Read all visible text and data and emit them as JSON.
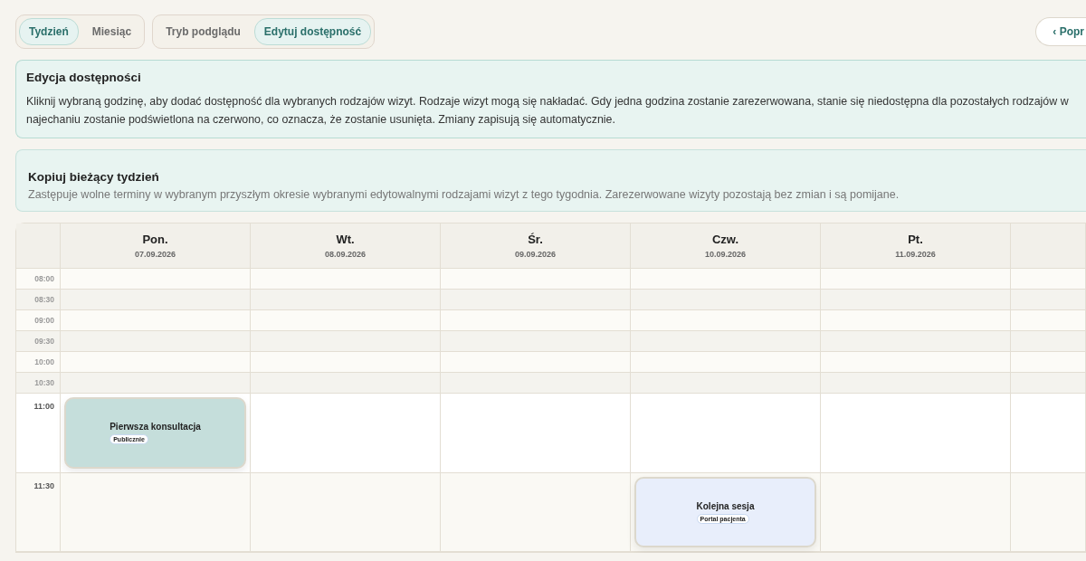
{
  "view_toggle": [
    {
      "label": "Tydzień",
      "selected": true
    },
    {
      "label": "Miesiąc",
      "selected": false
    }
  ],
  "mode_toggle": [
    {
      "label": "Tryb podglądu",
      "selected": false
    },
    {
      "label": "Edytuj dostępność",
      "selected": true
    }
  ],
  "prev_button": "‹ Popr",
  "info": {
    "title": "Edycja dostępności",
    "lines": [
      "Kliknij wybraną godzinę, aby dodać dostępność dla wybranych rodzajów wizyt. Rodzaje wizyt mogą się nakładać. Gdy jedna godzina zostanie zarezerwowana, stanie się niedostępna dla pozostałych rodzajów w",
      "najechaniu zostanie podświetlona na czerwono, co oznacza, że zostanie usunięta. Zmiany zapisują się automatycznie."
    ]
  },
  "copy": {
    "title": "Kopiuj bieżący tydzień",
    "description": "Zastępuje wolne terminy w wybranym przyszłym okresie wybranymi edytowalnymi rodzajami wizyt z tego tygodnia. Zarezerwowane wizyty pozostają bez zmian i są pomijane."
  },
  "calendar": {
    "days": [
      {
        "name": "Pon.",
        "date": "07.09.2026"
      },
      {
        "name": "Wt.",
        "date": "08.09.2026"
      },
      {
        "name": "Śr.",
        "date": "09.09.2026"
      },
      {
        "name": "Czw.",
        "date": "10.09.2026"
      },
      {
        "name": "Pt.",
        "date": "11.09.2026"
      }
    ],
    "rows": [
      {
        "time": "08:00",
        "cells": [
          {
            "kind": "empty"
          },
          {
            "kind": "empty"
          },
          {
            "kind": "empty"
          },
          {
            "kind": "empty"
          },
          {
            "kind": "empty"
          },
          {
            "kind": "empty"
          }
        ]
      },
      {
        "time": "08:30",
        "cells": [
          {
            "kind": "empty"
          },
          {
            "kind": "empty"
          },
          {
            "kind": "empty"
          },
          {
            "kind": "empty"
          },
          {
            "kind": "empty"
          },
          {
            "kind": "empty"
          }
        ]
      },
      {
        "time": "09:00",
        "cells": [
          {
            "kind": "empty"
          },
          {
            "kind": "empty"
          },
          {
            "kind": "empty"
          },
          {
            "kind": "empty"
          },
          {
            "kind": "empty"
          },
          {
            "kind": "empty"
          }
        ]
      },
      {
        "time": "09:30",
        "cells": [
          {
            "kind": "empty"
          },
          {
            "kind": "empty"
          },
          {
            "kind": "empty"
          },
          {
            "kind": "empty"
          },
          {
            "kind": "empty"
          },
          {
            "kind": "empty"
          }
        ]
      },
      {
        "time": "10:00",
        "cells": [
          {
            "kind": "empty"
          },
          {
            "kind": "empty"
          },
          {
            "kind": "empty"
          },
          {
            "kind": "empty"
          },
          {
            "kind": "empty"
          },
          {
            "kind": "empty"
          }
        ]
      },
      {
        "time": "10:30",
        "cells": [
          {
            "kind": "empty"
          },
          {
            "kind": "empty"
          },
          {
            "kind": "empty"
          },
          {
            "kind": "empty"
          },
          {
            "kind": "empty"
          },
          {
            "kind": "empty"
          }
        ]
      },
      {
        "time": "11:00",
        "cells": [
          {
            "kind": "event",
            "title": "Pierwsza konsultacja",
            "tag": "Publicznie",
            "color": "#c5dedb"
          },
          {
            "kind": "empty"
          },
          {
            "kind": "empty"
          },
          {
            "kind": "empty"
          },
          {
            "kind": "empty"
          },
          {
            "kind": "empty"
          }
        ]
      },
      {
        "time": "11:30",
        "cells": [
          {
            "kind": "empty"
          },
          {
            "kind": "empty"
          },
          {
            "kind": "empty"
          },
          {
            "kind": "event",
            "title": "Kolejna sesja",
            "tag": "Portal pacjenta",
            "color": "#e8eefb"
          },
          {
            "kind": "empty"
          },
          {
            "kind": "empty"
          }
        ]
      }
    ]
  }
}
